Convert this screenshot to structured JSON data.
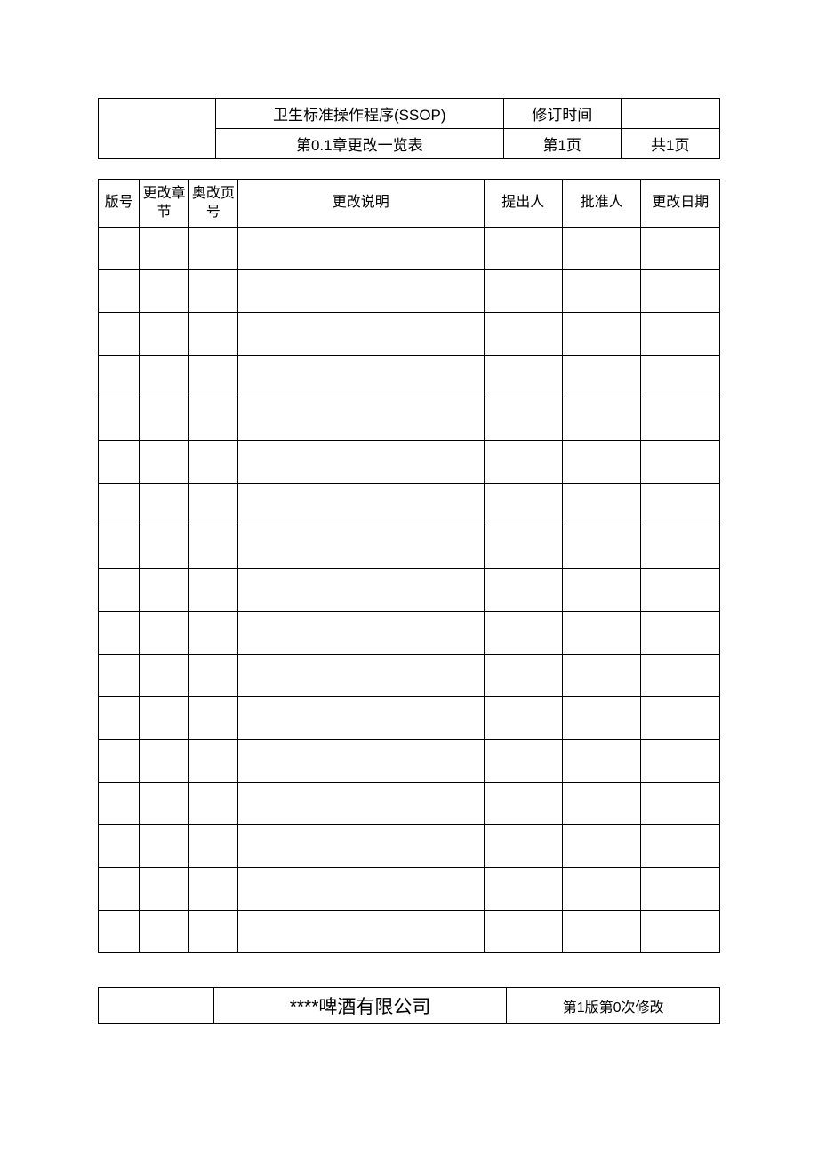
{
  "header": {
    "title_row1": "卫生标准操作程序(SSOP)",
    "revision_label": "修订时间",
    "revision_value": "",
    "title_row2": "第0.1章更改一览表",
    "page_current": "第1页",
    "page_total": "共1页"
  },
  "table": {
    "headers": {
      "version": "版号",
      "chapter": "更改章节",
      "page_num": "奥改页号",
      "description": "更改说明",
      "proposer": "提出人",
      "approver": "批准人",
      "change_date": "更改日期"
    },
    "row_count": 17
  },
  "footer": {
    "company": "****啤酒有限公司",
    "version_info": "第1版第0次修改"
  }
}
